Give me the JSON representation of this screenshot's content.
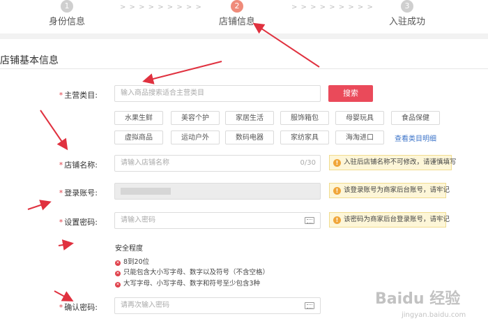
{
  "steps": [
    {
      "number": "1",
      "label": "身份信息"
    },
    {
      "number": "2",
      "label": "店铺信息"
    },
    {
      "number": "3",
      "label": "入驻成功"
    }
  ],
  "step_separator": "> > > > > > > > >",
  "active_step": 2,
  "section_title": "店铺基本信息",
  "form": {
    "category": {
      "label": "主营类目:",
      "placeholder": "输入商品搜索适合主营类目",
      "search_button": "搜索",
      "options": [
        "水果生鲜",
        "美容个护",
        "家居生活",
        "服饰箱包",
        "母婴玩具",
        "食品保健",
        "虚拟商品",
        "运动户外",
        "数码电器",
        "家纺家具",
        "海淘进口"
      ],
      "details_link": "查看类目明细"
    },
    "store_name": {
      "label": "店铺名称:",
      "placeholder": "请输入店铺名称",
      "counter": "0/30",
      "tip": "入驻后店铺名称不可修改，请谨慎填写"
    },
    "login_account": {
      "label": "登录账号:",
      "tip": "该登录账号为商家后台账号，请牢记"
    },
    "password": {
      "label": "设置密码:",
      "placeholder": "请输入密码",
      "tip": "该密码为商家后台登录账号，请牢记"
    },
    "strength": {
      "title": "安全程度",
      "rules": [
        "8到20位",
        "只能包含大小写字母、数字以及符号（不含空格）",
        "大写字母、小写字母、数字和符号至少包含3种"
      ]
    },
    "confirm_password": {
      "label": "确认密码:",
      "placeholder": "请再次输入密码"
    }
  },
  "watermark": {
    "text": "Baidu 经验",
    "sub": "jingyan.baidu.com"
  },
  "colors": {
    "accent": "#ea4a5a",
    "active_step": "#ef8b7a",
    "link": "#3c74c9",
    "tip_bg": "#fdf6d8",
    "annotation_arrow": "#e0313f"
  }
}
